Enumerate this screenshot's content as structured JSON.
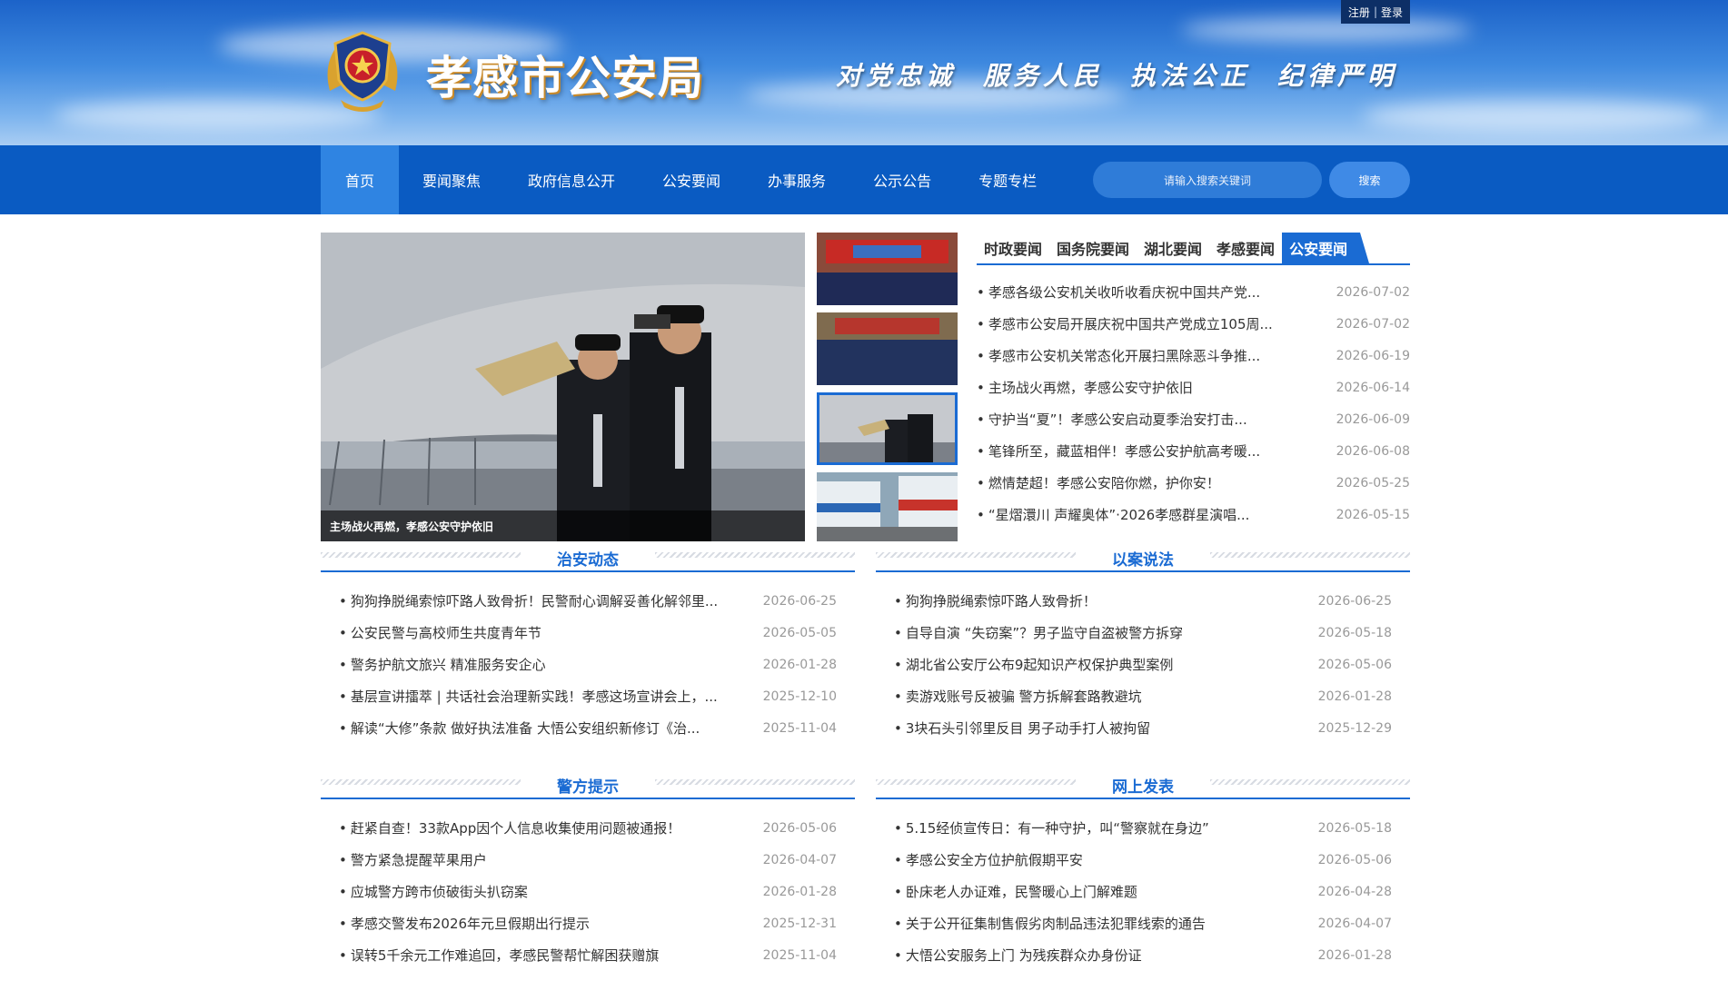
{
  "header": {
    "site_title": "孝感市公安局",
    "slogan": [
      "对党忠诚",
      "服务人民",
      "执法公正",
      "纪律严明"
    ],
    "register": "注册",
    "login": "登录"
  },
  "nav": {
    "items": [
      "首页",
      "要闻聚焦",
      "政府信息公开",
      "公安要闻",
      "办事服务",
      "公示公告",
      "专题专栏"
    ],
    "search_placeholder": "请输入搜索关键词",
    "search_button": "搜索"
  },
  "slider": {
    "caption": "主场战火再燃，孝感公安守护依旧"
  },
  "news": {
    "tabs": [
      "时政要闻",
      "国务院要闻",
      "湖北要闻",
      "孝感要闻",
      "公安要闻"
    ],
    "active_tab": 4,
    "items": [
      {
        "title": "孝感各级公安机关收听收看庆祝中国共产党...",
        "date": "2026-07-02"
      },
      {
        "title": "孝感市公安局开展庆祝中国共产党成立105周...",
        "date": "2026-07-02"
      },
      {
        "title": "孝感市公安机关常态化开展扫黑除恶斗争推...",
        "date": "2026-06-19"
      },
      {
        "title": "主场战火再燃，孝感公安守护依旧",
        "date": "2026-06-14"
      },
      {
        "title": "守护当“夏”！孝感公安启动夏季治安打击...",
        "date": "2026-06-09"
      },
      {
        "title": "笔锋所至，藏蓝相伴！孝感公安护航高考暖...",
        "date": "2026-06-08"
      },
      {
        "title": "燃情楚超！孝感公安陪你燃，护你安！",
        "date": "2026-05-25"
      },
      {
        "title": "“星熠澴川 声耀奥体”·2026孝感群星演唱...",
        "date": "2026-05-15"
      }
    ]
  },
  "sections": [
    {
      "title": "治安动态",
      "items": [
        {
          "title": "狗狗挣脱绳索惊吓路人致骨折！民警耐心调解妥善化解邻里...",
          "date": "2026-06-25"
        },
        {
          "title": "公安民警与高校师生共度青年节",
          "date": "2026-05-05"
        },
        {
          "title": "警务护航文旅兴 精准服务安企心",
          "date": "2026-01-28"
        },
        {
          "title": "基层宣讲擂萃 | 共话社会治理新实践！孝感这场宣讲会上，...",
          "date": "2025-12-10"
        },
        {
          "title": "解读“大修”条款 做好执法准备 大悟公安组织新修订《治...",
          "date": "2025-11-04"
        }
      ]
    },
    {
      "title": "以案说法",
      "items": [
        {
          "title": "狗狗挣脱绳索惊吓路人致骨折！",
          "date": "2026-06-25"
        },
        {
          "title": "自导自演 “失窃案”？男子监守自盗被警方拆穿",
          "date": "2026-05-18"
        },
        {
          "title": "湖北省公安厅公布9起知识产权保护典型案例",
          "date": "2026-05-06"
        },
        {
          "title": "卖游戏账号反被骗 警方拆解套路教避坑",
          "date": "2026-01-28"
        },
        {
          "title": "3块石头引邻里反目 男子动手打人被拘留",
          "date": "2025-12-29"
        }
      ]
    },
    {
      "title": "警方提示",
      "items": [
        {
          "title": "赶紧自查！33款App因个人信息收集使用问题被通报！",
          "date": "2026-05-06"
        },
        {
          "title": "警方紧急提醒苹果用户",
          "date": "2026-04-07"
        },
        {
          "title": "应城警方跨市侦破街头扒窃案",
          "date": "2026-01-28"
        },
        {
          "title": "孝感交警发布2026年元旦假期出行提示",
          "date": "2025-12-31"
        },
        {
          "title": "误转5千余元工作难追回，孝感民警帮忙解困获赠旗",
          "date": "2025-11-04"
        }
      ]
    },
    {
      "title": "网上发表",
      "items": [
        {
          "title": "5.15经侦宣传日：有一种守护，叫“警察就在身边”",
          "date": "2026-05-18"
        },
        {
          "title": "孝感公安全方位护航假期平安",
          "date": "2026-05-06"
        },
        {
          "title": "卧床老人办证难，民警暖心上门解难题",
          "date": "2026-04-28"
        },
        {
          "title": "关于公开征集制售假劣肉制品违法犯罪线索的通告",
          "date": "2026-04-07"
        },
        {
          "title": "大悟公安服务上门 为残疾群众办身份证",
          "date": "2026-01-28"
        }
      ]
    }
  ]
}
